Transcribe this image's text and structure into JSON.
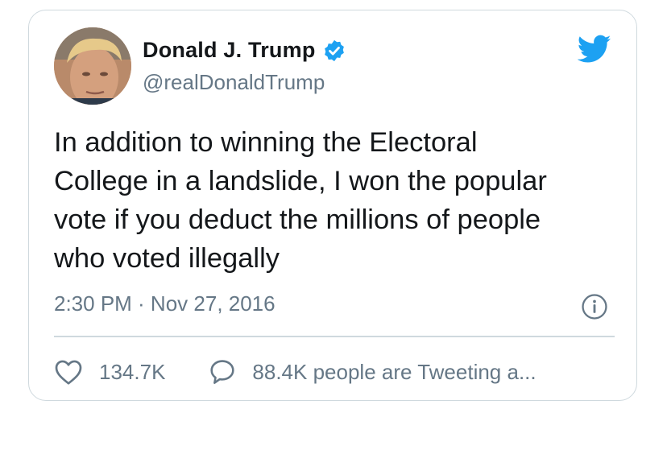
{
  "tweet": {
    "display_name": "Donald J. Trump",
    "handle": "@realDonaldTrump",
    "verified": true,
    "text": "In addition to winning the Electoral\nCollege in a landslide, I won the popular\nvote if you deduct the millions of people\nwho voted illegally",
    "timestamp": "2:30 PM · Nov 27, 2016",
    "likes": "134.7K",
    "tweeting_text": "88.4K people are Tweeting a..."
  },
  "icons": {
    "brand": "twitter-bird-icon",
    "verified": "verified-badge-icon",
    "info": "info-icon",
    "like": "heart-icon",
    "reply": "speech-bubble-icon"
  },
  "colors": {
    "accent": "#1da1f2",
    "text": "#14171a",
    "secondary": "#657786",
    "border": "#cfd9de"
  }
}
